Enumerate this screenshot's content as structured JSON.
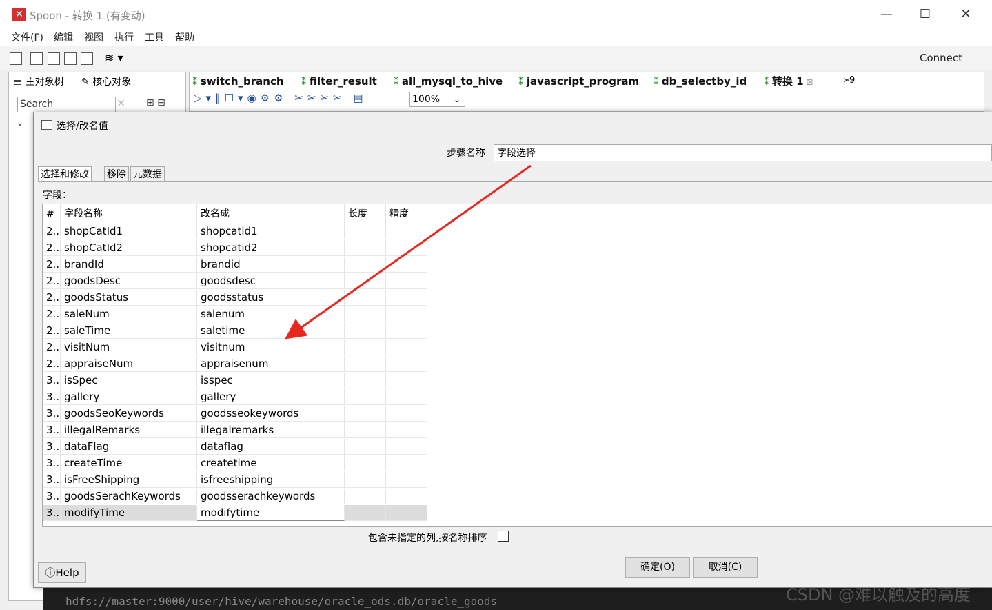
{
  "window": {
    "title": "Spoon - 转换 1 (有变动)",
    "minimize": "—",
    "maximize": "☐",
    "close": "✕"
  },
  "menu": [
    "文件(F)",
    "编辑",
    "视图",
    "执行",
    "工具",
    "帮助"
  ],
  "toolbar": {
    "connect": "Connect"
  },
  "left_panel": {
    "tabs": [
      "主对象树",
      "核心对象"
    ],
    "search_placeholder": "Search"
  },
  "editor_tabs": [
    "switch_branch",
    "filter_result",
    "all_mysql_to_hive",
    "javascript_program",
    "db_selectby_id",
    "转换 1"
  ],
  "editor_more": "»9",
  "zoom": "100%",
  "dialog": {
    "title": "选择/改名值",
    "step_name_label": "步骤名称",
    "step_name_value": "字段选择",
    "tabs": [
      "选择和修改",
      "移除",
      "元数据"
    ],
    "fields_label": "字段：",
    "columns": [
      "#",
      "字段名称",
      "改名成",
      "长度",
      "精度"
    ],
    "rows": [
      {
        "n": "2..",
        "name": "shopCatId1",
        "rename": "shopcatid1"
      },
      {
        "n": "2..",
        "name": "shopCatId2",
        "rename": "shopcatid2"
      },
      {
        "n": "2..",
        "name": "brandId",
        "rename": "brandid"
      },
      {
        "n": "2..",
        "name": "goodsDesc",
        "rename": "goodsdesc"
      },
      {
        "n": "2..",
        "name": "goodsStatus",
        "rename": "goodsstatus"
      },
      {
        "n": "2..",
        "name": "saleNum",
        "rename": "salenum"
      },
      {
        "n": "2..",
        "name": "saleTime",
        "rename": "saletime"
      },
      {
        "n": "2..",
        "name": "visitNum",
        "rename": "visitnum"
      },
      {
        "n": "2..",
        "name": "appraiseNum",
        "rename": "appraisenum"
      },
      {
        "n": "3..",
        "name": "isSpec",
        "rename": "isspec"
      },
      {
        "n": "3..",
        "name": "gallery",
        "rename": "gallery"
      },
      {
        "n": "3..",
        "name": "goodsSeoKeywords",
        "rename": "goodsseokeywords"
      },
      {
        "n": "3..",
        "name": "illegalRemarks",
        "rename": "illegalremarks"
      },
      {
        "n": "3..",
        "name": "dataFlag",
        "rename": "dataflag"
      },
      {
        "n": "3..",
        "name": "createTime",
        "rename": "createtime"
      },
      {
        "n": "3..",
        "name": "isFreeShipping",
        "rename": "isfreeshipping"
      },
      {
        "n": "3..",
        "name": "goodsSerachKeywords",
        "rename": "goodsserachkeywords"
      },
      {
        "n": "3..",
        "name": "modifyTime",
        "rename": "modifytime"
      }
    ],
    "sort_label": "包含未指定的列,按名称排序",
    "ok": "确定(O)",
    "cancel": "取消(C)",
    "help": "Help"
  },
  "bottom_text": "hdfs://master:9000/user/hive/warehouse/oracle_ods.db/oracle_goods",
  "watermark": "CSDN @难以触及的高度",
  "colors": {
    "arrow": "#e8281e",
    "tab_icon": "#2e8b2e",
    "app_icon": "#d32f2f"
  }
}
